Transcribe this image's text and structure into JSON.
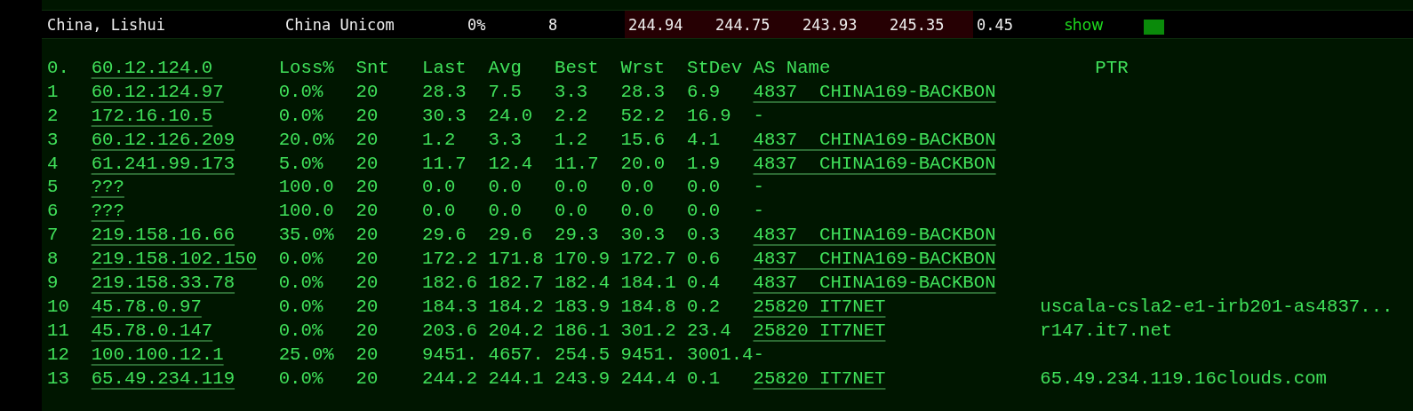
{
  "summary": {
    "location": "China, Lishui",
    "isp": "China Unicom",
    "loss": "0%",
    "count": "8",
    "latencies": [
      "244.94",
      "244.75",
      "243.93",
      "245.35"
    ],
    "stdev": "0.45",
    "details_link": "show"
  },
  "trace": {
    "columns": [
      "Loss%",
      "Snt",
      "Last",
      "Avg",
      "Best",
      "Wrst",
      "StDev",
      "AS Name",
      "PTR"
    ],
    "header": {
      "hop": "0.",
      "host": "60.12.124.0"
    },
    "rows": [
      {
        "hop": "1",
        "host": "60.12.124.97",
        "loss": "0.0%",
        "snt": "20",
        "last": "28.3",
        "avg": "7.5",
        "best": "3.3",
        "wrst": "28.3",
        "stdev": "6.9",
        "as": "4837  CHINA169-BACKBON",
        "as_linked": true,
        "ptr": ""
      },
      {
        "hop": "2",
        "host": "172.16.10.5",
        "loss": "0.0%",
        "snt": "20",
        "last": "30.3",
        "avg": "24.0",
        "best": "2.2",
        "wrst": "52.2",
        "stdev": "16.9",
        "as": "-",
        "as_linked": false
      },
      {
        "hop": "3",
        "host": "60.12.126.209",
        "loss": "20.0%",
        "snt": "20",
        "last": "1.2",
        "avg": "3.3",
        "best": "1.2",
        "wrst": "15.6",
        "stdev": "4.1",
        "as": "4837  CHINA169-BACKBON",
        "as_linked": true
      },
      {
        "hop": "4",
        "host": "61.241.99.173",
        "loss": "5.0%",
        "snt": "20",
        "last": "11.7",
        "avg": "12.4",
        "best": "11.7",
        "wrst": "20.0",
        "stdev": "1.9",
        "as": "4837  CHINA169-BACKBON",
        "as_linked": true
      },
      {
        "hop": "5",
        "host": "???",
        "loss": "100.0",
        "snt": "20",
        "last": "0.0",
        "avg": "0.0",
        "best": "0.0",
        "wrst": "0.0",
        "stdev": "0.0",
        "as": "-",
        "as_linked": false
      },
      {
        "hop": "6",
        "host": "???",
        "loss": "100.0",
        "snt": "20",
        "last": "0.0",
        "avg": "0.0",
        "best": "0.0",
        "wrst": "0.0",
        "stdev": "0.0",
        "as": "-",
        "as_linked": false
      },
      {
        "hop": "7",
        "host": "219.158.16.66",
        "loss": "35.0%",
        "snt": "20",
        "last": "29.6",
        "avg": "29.6",
        "best": "29.3",
        "wrst": "30.3",
        "stdev": "0.3",
        "as": "4837  CHINA169-BACKBON",
        "as_linked": true
      },
      {
        "hop": "8",
        "host": "219.158.102.150",
        "loss": "0.0%",
        "snt": "20",
        "last": "172.2",
        "avg": "171.8",
        "best": "170.9",
        "wrst": "172.7",
        "stdev": "0.6",
        "as": "4837  CHINA169-BACKBON",
        "as_linked": true
      },
      {
        "hop": "9",
        "host": "219.158.33.78",
        "loss": "0.0%",
        "snt": "20",
        "last": "182.6",
        "avg": "182.7",
        "best": "182.4",
        "wrst": "184.1",
        "stdev": "0.4",
        "as": "4837  CHINA169-BACKBON",
        "as_linked": true
      },
      {
        "hop": "10",
        "host": "45.78.0.97",
        "loss": "0.0%",
        "snt": "20",
        "last": "184.3",
        "avg": "184.2",
        "best": "183.9",
        "wrst": "184.8",
        "stdev": "0.2",
        "as": "25820 IT7NET",
        "as_linked": true,
        "ptr": "uscala-csla2-e1-irb201-as4837..."
      },
      {
        "hop": "11",
        "host": "45.78.0.147",
        "loss": "0.0%",
        "snt": "20",
        "last": "203.6",
        "avg": "204.2",
        "best": "186.1",
        "wrst": "301.2",
        "stdev": "23.4",
        "as": "25820 IT7NET",
        "as_linked": true,
        "ptr": "r147.it7.net"
      },
      {
        "hop": "12",
        "host": "100.100.12.1",
        "loss": "25.0%",
        "snt": "20",
        "last": "9451.",
        "avg": "4657.",
        "best": "254.5",
        "wrst": "9451.",
        "stdev": "3001.4",
        "as": "-",
        "as_linked": false
      },
      {
        "hop": "13",
        "host": "65.49.234.119",
        "loss": "0.0%",
        "snt": "20",
        "last": "244.2",
        "avg": "244.1",
        "best": "243.9",
        "wrst": "244.4",
        "stdev": "0.1",
        "as": "25820 IT7NET",
        "as_linked": true,
        "ptr": "65.49.234.119.16clouds.com"
      }
    ]
  }
}
